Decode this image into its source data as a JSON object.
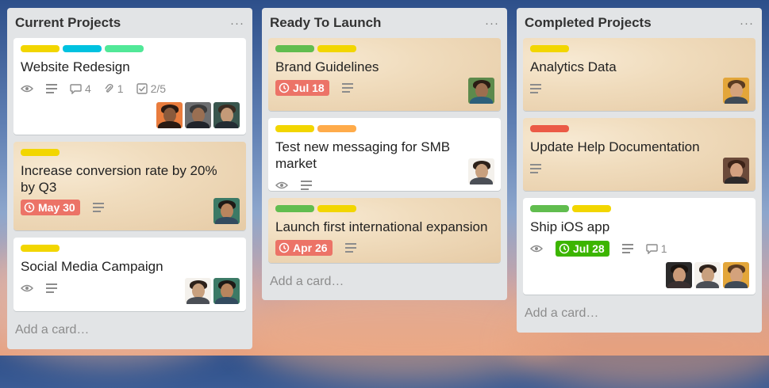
{
  "colors": {
    "yellow": "#f2d600",
    "blue": "#00c2e0",
    "teal": "#51e898",
    "green": "#61bd4f",
    "orange": "#ffab4a",
    "red": "#eb5a46",
    "due_red": "#ec7367",
    "due_green": "#3cb500"
  },
  "lists": [
    {
      "title": "Current Projects",
      "menu": "···",
      "add_card": "Add a card…",
      "cards": [
        {
          "title": "Website Redesign",
          "labels": [
            "yellow",
            "blue",
            "teal"
          ],
          "comments": "4",
          "attachments": "1",
          "checklist": "2/5",
          "members": [
            "avatar-woman",
            "avatar-man-glasses",
            "avatar-man-beard"
          ]
        },
        {
          "title": "Increase conversion rate by 20% by Q3",
          "labels": [
            "yellow"
          ],
          "due": "May 30",
          "members": [
            "avatar-man-smile"
          ]
        },
        {
          "title": "Social Media Campaign",
          "labels": [
            "yellow"
          ],
          "members": [
            "avatar-man-curly",
            "avatar-man-smile"
          ]
        }
      ]
    },
    {
      "title": "Ready To Launch",
      "menu": "···",
      "add_card": "Add a card…",
      "cards": [
        {
          "title": "Brand Guidelines",
          "labels": [
            "green",
            "yellow"
          ],
          "due": "Jul 18",
          "members": [
            "avatar-woman-green"
          ]
        },
        {
          "title": "Test new messaging for SMB market",
          "labels": [
            "yellow",
            "orange"
          ],
          "members": [
            "avatar-man-curly"
          ]
        },
        {
          "title": "Launch first international expansion",
          "labels": [
            "green",
            "yellow"
          ],
          "due": "Apr 26"
        }
      ]
    },
    {
      "title": "Completed Projects",
      "menu": "···",
      "add_card": "Add a card…",
      "cards": [
        {
          "title": "Analytics Data",
          "labels": [
            "yellow"
          ],
          "members": [
            "avatar-man-orange"
          ]
        },
        {
          "title": "Update Help Documentation",
          "labels": [
            "red"
          ],
          "members": [
            "avatar-woman-brown"
          ]
        },
        {
          "title": "Ship iOS app",
          "labels": [
            "green",
            "yellow"
          ],
          "due": "Jul 28",
          "comments": "1",
          "members": [
            "avatar-woman-dark",
            "avatar-man-curly",
            "avatar-man-orange"
          ]
        }
      ]
    }
  ]
}
